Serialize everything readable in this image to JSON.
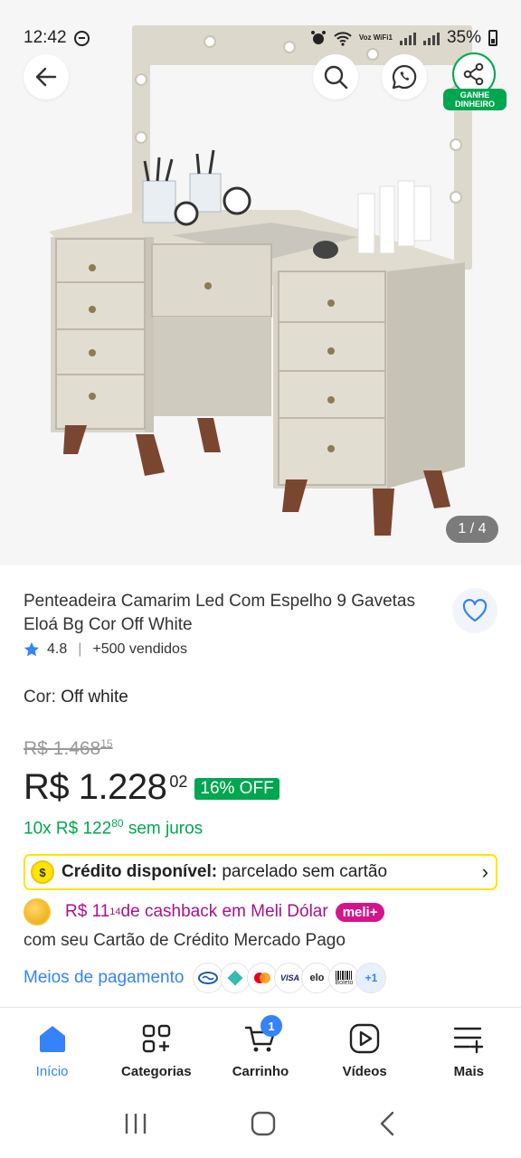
{
  "status_bar": {
    "time": "12:42",
    "network_label": "Voz WiFi1",
    "battery": "35%"
  },
  "hero": {
    "image_counter": "1 / 4",
    "share_label": "GANHE DINHEIRO"
  },
  "product": {
    "title": "Penteadeira Camarim Led Com Espelho 9 Gavetas Eloá Bg Cor Off White",
    "rating": "4.8",
    "sold": "+500 vendidos",
    "color_label": "Cor:",
    "color_value": "Off white",
    "old_price": "R$ 1.468",
    "old_price_cents": "15",
    "price": "R$ 1.228",
    "price_cents": "02",
    "discount": "16% OFF",
    "installments_prefix": "10x R$ 122",
    "installments_cents": "80",
    "installments_suffix": " sem juros"
  },
  "credit": {
    "label": "Crédito disponível:",
    "text": " parcelado sem cartão"
  },
  "cashback": {
    "amount": "R$ 11",
    "amount_cents": "14",
    "text": " de cashback em Meli Dólar",
    "badge": "meli+",
    "card_text": "com seu Cartão de Crédito Mercado Pago"
  },
  "payment": {
    "link": "Meios de pagamento",
    "icons": [
      "mercado-pago",
      "pix",
      "mastercard",
      "visa",
      "elo",
      "boleto"
    ],
    "more": "+1",
    "visa_label": "VISA",
    "elo_label": "elo",
    "boleto_label": "Boleto"
  },
  "bottom_nav": {
    "items": [
      {
        "label": "Início",
        "icon": "home-icon"
      },
      {
        "label": "Categorias",
        "icon": "categories-icon"
      },
      {
        "label": "Carrinho",
        "icon": "cart-icon",
        "badge": "1"
      },
      {
        "label": "Vídeos",
        "icon": "play-icon"
      },
      {
        "label": "Mais",
        "icon": "menu-plus-icon"
      }
    ]
  },
  "colors": {
    "accent": "#3483fa",
    "green": "#00a650",
    "meli": "#d4148c",
    "yellow": "#ffe600"
  }
}
